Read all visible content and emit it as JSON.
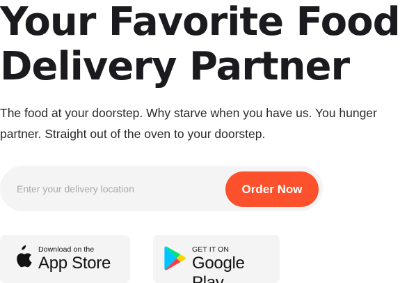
{
  "hero": {
    "headline_line1": "Your Favorite Food",
    "headline_line2": "Delivery Partner",
    "tagline": "The food at your doorstep. Why starve when you have us. You hunger partner. Straight out of the oven to your doorstep."
  },
  "search": {
    "placeholder": "Enter your delivery location",
    "value": "",
    "button_label": "Order Now",
    "button_color": "#fc512c"
  },
  "badges": {
    "appstore": {
      "icon": "apple-icon",
      "small": "Download on the",
      "big": "App Store"
    },
    "googleplay": {
      "icon": "google-play-icon",
      "small": "GET IT ON",
      "big": "Google Play"
    }
  }
}
